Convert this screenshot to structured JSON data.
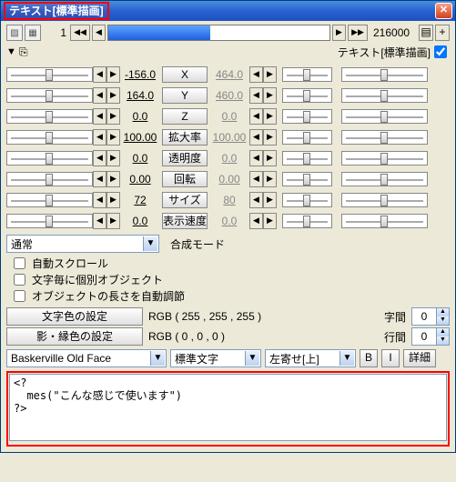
{
  "title": "テキスト[標準描画]",
  "timeline": {
    "frame": 1,
    "total": 216000
  },
  "layer": {
    "label": "テキスト[標準描画]",
    "checked": true
  },
  "params": [
    {
      "name": "x",
      "left": "-156.0",
      "btn": "X",
      "right": "464.0"
    },
    {
      "name": "y",
      "left": "164.0",
      "btn": "Y",
      "right": "460.0"
    },
    {
      "name": "z",
      "left": "0.0",
      "btn": "Z",
      "right": "0.0"
    },
    {
      "name": "zoom",
      "left": "100.00",
      "btn": "拡大率",
      "right": "100.00"
    },
    {
      "name": "alpha",
      "left": "0.0",
      "btn": "透明度",
      "right": "0.0"
    },
    {
      "name": "rot",
      "left": "0.00",
      "btn": "回転",
      "right": "0.00"
    },
    {
      "name": "size",
      "left": "72",
      "btn": "サイズ",
      "right": "80"
    },
    {
      "name": "speed",
      "left": "0.0",
      "btn": "表示速度",
      "right": "0.0"
    }
  ],
  "blend": {
    "mode": "通常",
    "label": "合成モード"
  },
  "checkboxes": {
    "autoscroll": "自動スクロール",
    "perchar": "文字毎に個別オブジェクト",
    "autofit": "オブジェクトの長さを自動調節"
  },
  "settings": {
    "text_color": {
      "btn": "文字色の設定",
      "rgb": "RGB ( 255 , 255 , 255 )"
    },
    "shadow_color": {
      "btn": "影・縁色の設定",
      "rgb": "RGB ( 0 , 0 , 0 )"
    },
    "char_spacing": {
      "label": "字間",
      "value": 0
    },
    "line_spacing": {
      "label": "行間",
      "value": 0
    }
  },
  "font_row": {
    "font": "Baskerville Old Face",
    "style": "標準文字",
    "align": "左寄せ[上]",
    "bold": "B",
    "italic": "I",
    "detail": "詳細"
  },
  "script": "<?\n  mes(\"こんな感じで使います\")\n?>"
}
